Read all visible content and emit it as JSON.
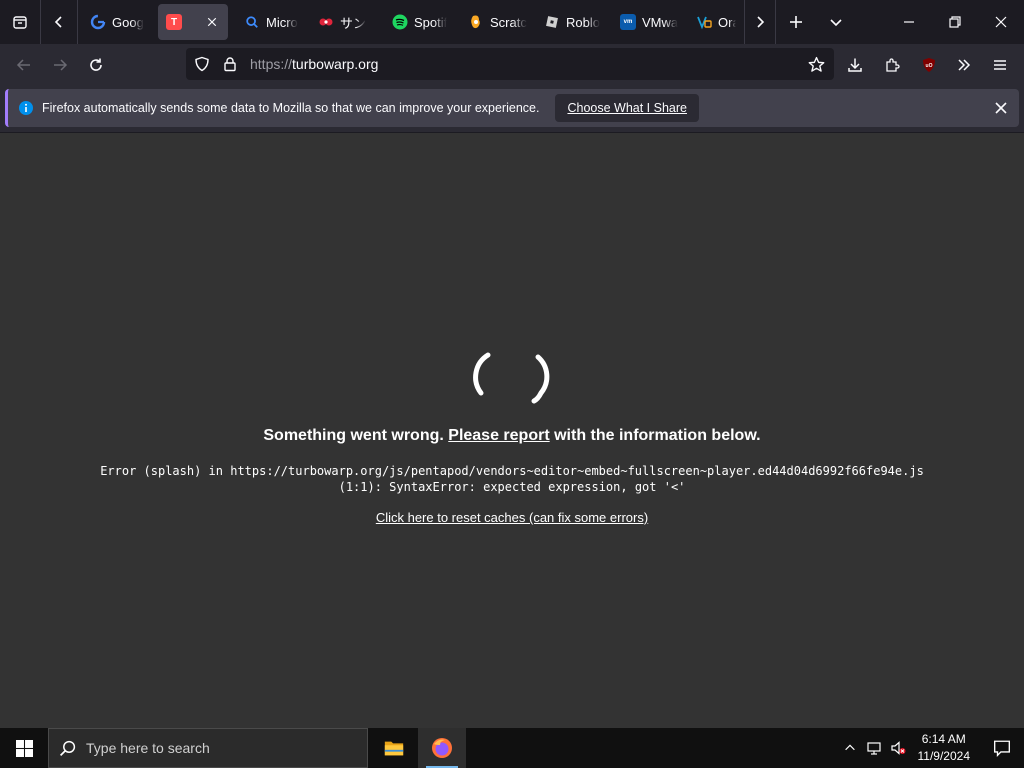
{
  "browser": {
    "tabs": [
      {
        "title": "Goog",
        "icon": "google-icon"
      },
      {
        "title": "",
        "icon": "turbowarp-icon",
        "active": true
      },
      {
        "title": "Micro",
        "icon": "search-icon"
      },
      {
        "title": "サン",
        "icon": "sanrio-icon"
      },
      {
        "title": "Spotif",
        "icon": "spotify-icon"
      },
      {
        "title": "Scratc",
        "icon": "scratch-icon"
      },
      {
        "title": "Roblo",
        "icon": "roblox-icon"
      },
      {
        "title": "VMwa",
        "icon": "vmware-icon"
      },
      {
        "title": "Ora",
        "icon": "oracle-icon"
      }
    ],
    "url": {
      "scheme": "https://",
      "host": "turbowarp.org"
    }
  },
  "notification": {
    "message": "Firefox automatically sends some data to Mozilla so that we can improve your experience.",
    "button_label": "Choose What I Share"
  },
  "page": {
    "error_heading_prefix": "Something went wrong. ",
    "error_heading_link": "Please report",
    "error_heading_suffix": " with the information below.",
    "error_line1": "Error (splash) in https://turbowarp.org/js/pentapod/vendors~editor~embed~fullscreen~player.ed44d04d6992f66fe94e.js",
    "error_line2": "(1:1): SyntaxError: expected expression, got '<'",
    "reset_link": "Click here to reset caches (can fix some errors)"
  },
  "taskbar": {
    "search_placeholder": "Type here to search",
    "time": "6:14 AM",
    "date": "11/9/2024"
  },
  "colors": {
    "accent": "#a37dfc",
    "info_blue": "#0090ed",
    "taskbar_active": "#76b9ed"
  }
}
